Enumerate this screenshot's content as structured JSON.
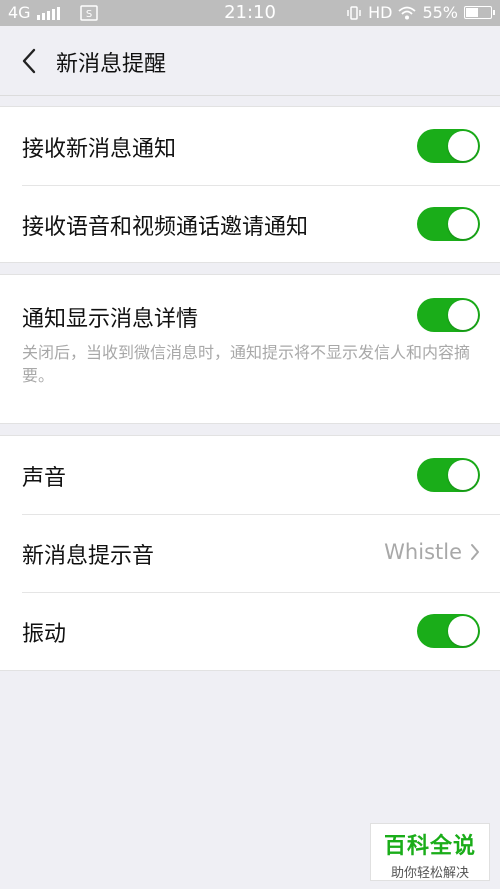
{
  "status_bar": {
    "network": "4G",
    "time": "21:10",
    "hd": "HD",
    "battery": "55%",
    "battery_level": 0.55
  },
  "header": {
    "title": "新消息提醒"
  },
  "group1": {
    "items": [
      {
        "label": "接收新消息通知",
        "enabled": true
      },
      {
        "label": "接收语音和视频通话邀请通知",
        "enabled": true
      }
    ]
  },
  "group2": {
    "label": "通知显示消息详情",
    "enabled": true,
    "description": "关闭后，当收到微信消息时，通知提示将不显示发信人和内容摘要。"
  },
  "group3": {
    "sound": {
      "label": "声音",
      "enabled": true
    },
    "tone": {
      "label": "新消息提示音",
      "value": "Whistle"
    },
    "vibrate": {
      "label": "振动",
      "enabled": true
    }
  },
  "watermark": {
    "title": "百科全说",
    "subtitle": "助你轻松解决"
  },
  "colors": {
    "accent": "#1aad19",
    "background": "#efeff4"
  }
}
